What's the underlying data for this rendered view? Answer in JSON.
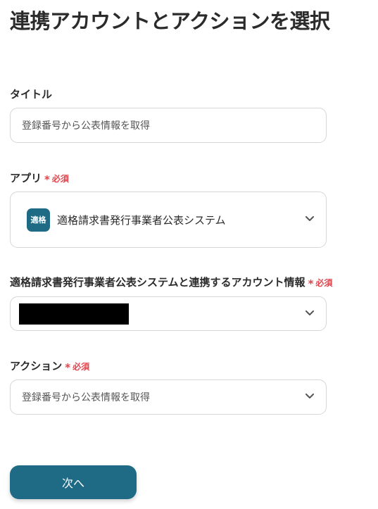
{
  "page": {
    "title": "連携アカウントとアクションを選択"
  },
  "required_badge": "必須",
  "title_field": {
    "label": "タイトル",
    "value": "登録番号から公表情報を取得"
  },
  "app_field": {
    "label": "アプリ",
    "icon_text": "適格",
    "value": "適格請求書発行事業者公表システム"
  },
  "account_field": {
    "label": "適格請求書発行事業者公表システムと連携するアカウント情報",
    "value_redacted": true
  },
  "action_field": {
    "label": "アクション",
    "value": "登録番号から公表情報を取得"
  },
  "next_button": {
    "label": "次へ"
  },
  "colors": {
    "primary": "#1f6b86",
    "required": "#e0434b",
    "border": "#d6d6d6"
  }
}
